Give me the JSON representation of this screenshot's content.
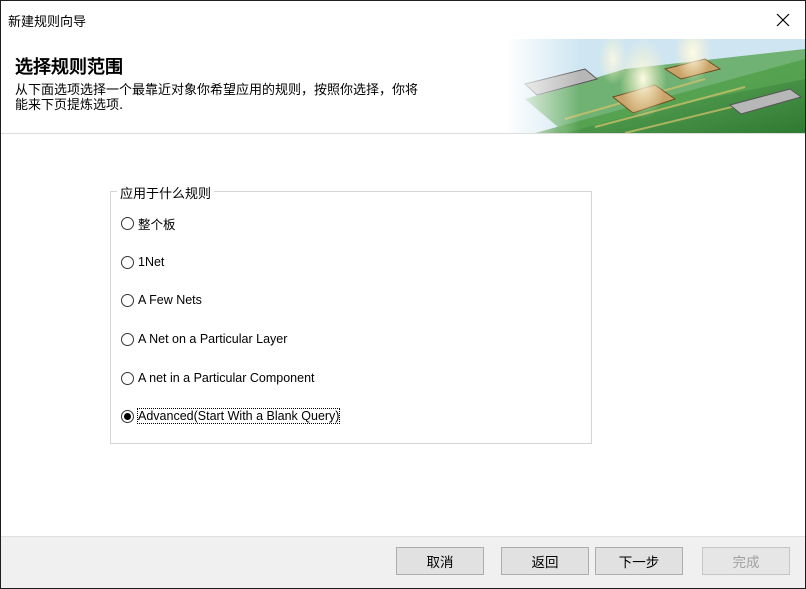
{
  "window": {
    "title": "新建规则向导"
  },
  "header": {
    "heading": "选择规则范围",
    "description_line1": "从下面选项选择一个最靠近对象你希望应用的规则，按照你选择，你将",
    "description_line2": "能来下页提炼选项."
  },
  "group": {
    "legend": "应用于什么规则",
    "options": [
      {
        "label": "整个板",
        "checked": false
      },
      {
        "label": "1Net",
        "checked": false
      },
      {
        "label": "A Few Nets",
        "checked": false
      },
      {
        "label": "A Net on a Particular Layer",
        "checked": false
      },
      {
        "label": "A net in a Particular Component",
        "checked": false
      },
      {
        "label": "Advanced(Start With a Blank Query)",
        "checked": true
      }
    ]
  },
  "buttons": {
    "cancel": "取消",
    "back": "返回",
    "next": "下一步",
    "finish": "完成"
  },
  "icons": {
    "close": "close-icon",
    "banner": "pcb-chip-illustration"
  },
  "colors": {
    "pcb_green": "#3c8f3a",
    "glow": "#fff3c4",
    "footer_bg": "#f0f0f0"
  }
}
